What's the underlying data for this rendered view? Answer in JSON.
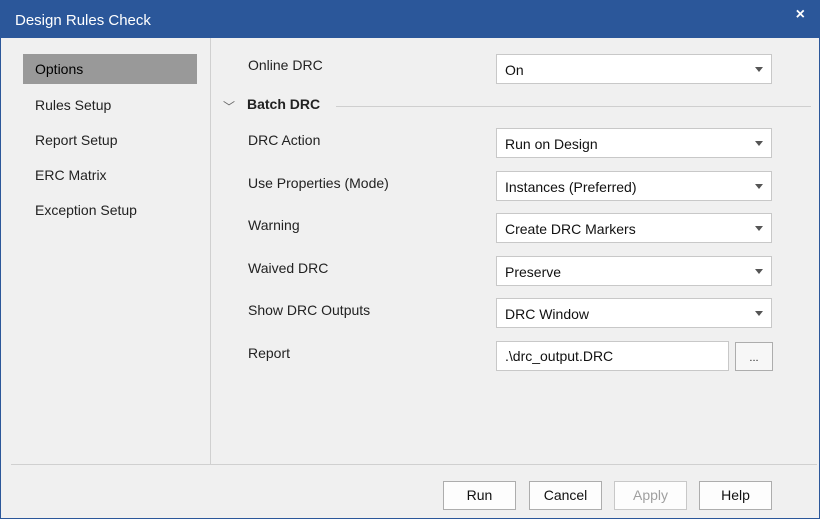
{
  "window": {
    "title": "Design Rules Check",
    "close_glyph": "×"
  },
  "sidebar": {
    "items": [
      {
        "label": "Options"
      },
      {
        "label": "Rules Setup"
      },
      {
        "label": "Report Setup"
      },
      {
        "label": "ERC Matrix"
      },
      {
        "label": "Exception Setup"
      }
    ],
    "selected": "Options"
  },
  "options": {
    "online_drc": {
      "label": "Online DRC",
      "value": "On"
    },
    "batch_drc": {
      "heading": "Batch DRC"
    },
    "drc_action": {
      "label": "DRC Action",
      "value": "Run on Design"
    },
    "use_properties": {
      "label": "Use Properties (Mode)",
      "value": "Instances (Preferred)"
    },
    "warning": {
      "label": "Warning",
      "value": "Create DRC Markers"
    },
    "waived_drc": {
      "label": "Waived DRC",
      "value": "Preserve"
    },
    "show_outputs": {
      "label": "Show DRC Outputs",
      "value": "DRC Window"
    },
    "report": {
      "label": "Report",
      "value": ".\\drc_output.DRC",
      "browse_label": "..."
    }
  },
  "footer": {
    "run_label": "Run",
    "cancel_label": "Cancel",
    "apply_label": "Apply",
    "help_label": "Help"
  },
  "colors": {
    "titlebar": "#2b579a",
    "selected_nav": "#999999"
  },
  "icons": {
    "close": "close-icon",
    "collapse": "chevron-down-icon",
    "dropdown": "dropdown-arrow-icon"
  }
}
